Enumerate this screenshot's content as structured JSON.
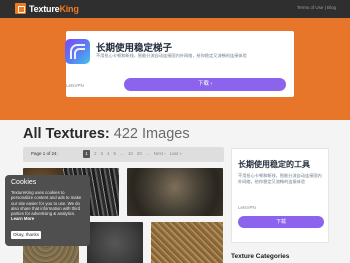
{
  "header": {
    "logo_text_a": "Texture",
    "logo_text_b": "King",
    "links": "Terms of Use | Blog"
  },
  "ad_banner": {
    "title": "长期使用稳定梯子",
    "description": "不用担心卡顿和断线，智能分流自动连接国内外网络，给你稳定又流畅的连接体验",
    "brand": "LetsVPN",
    "button": "下载 ›"
  },
  "main": {
    "title_bold": "All Textures:",
    "title_count": "422 Images"
  },
  "pager": {
    "label": "Page 1 of 24:",
    "current": "1",
    "pages": [
      "2",
      "3",
      "4",
      "5",
      "...",
      "10",
      "20",
      "...",
      "Next ›",
      "Last »"
    ]
  },
  "cookie": {
    "title": "Cookies",
    "text": "TextureKing uses cookies to personalize content and ads to make our site easier for you to use. We do also share that information with third parties for advertising & analytics.",
    "learn_more": "Learn More",
    "button": "Okay, thanks"
  },
  "side_ad": {
    "title": "长期使用稳定的工具",
    "description": "不用担心卡顿和断线，智能分流自动连接国内外网络，给你稳定又流畅的连接体验",
    "brand": "LetsVPN",
    "button": "下载"
  },
  "sidebar": {
    "categories_heading": "Texture Categories"
  },
  "colors": {
    "accent": "#e8762a",
    "ad_button": "#8b63ec",
    "topbar": "#2f2f2f"
  }
}
